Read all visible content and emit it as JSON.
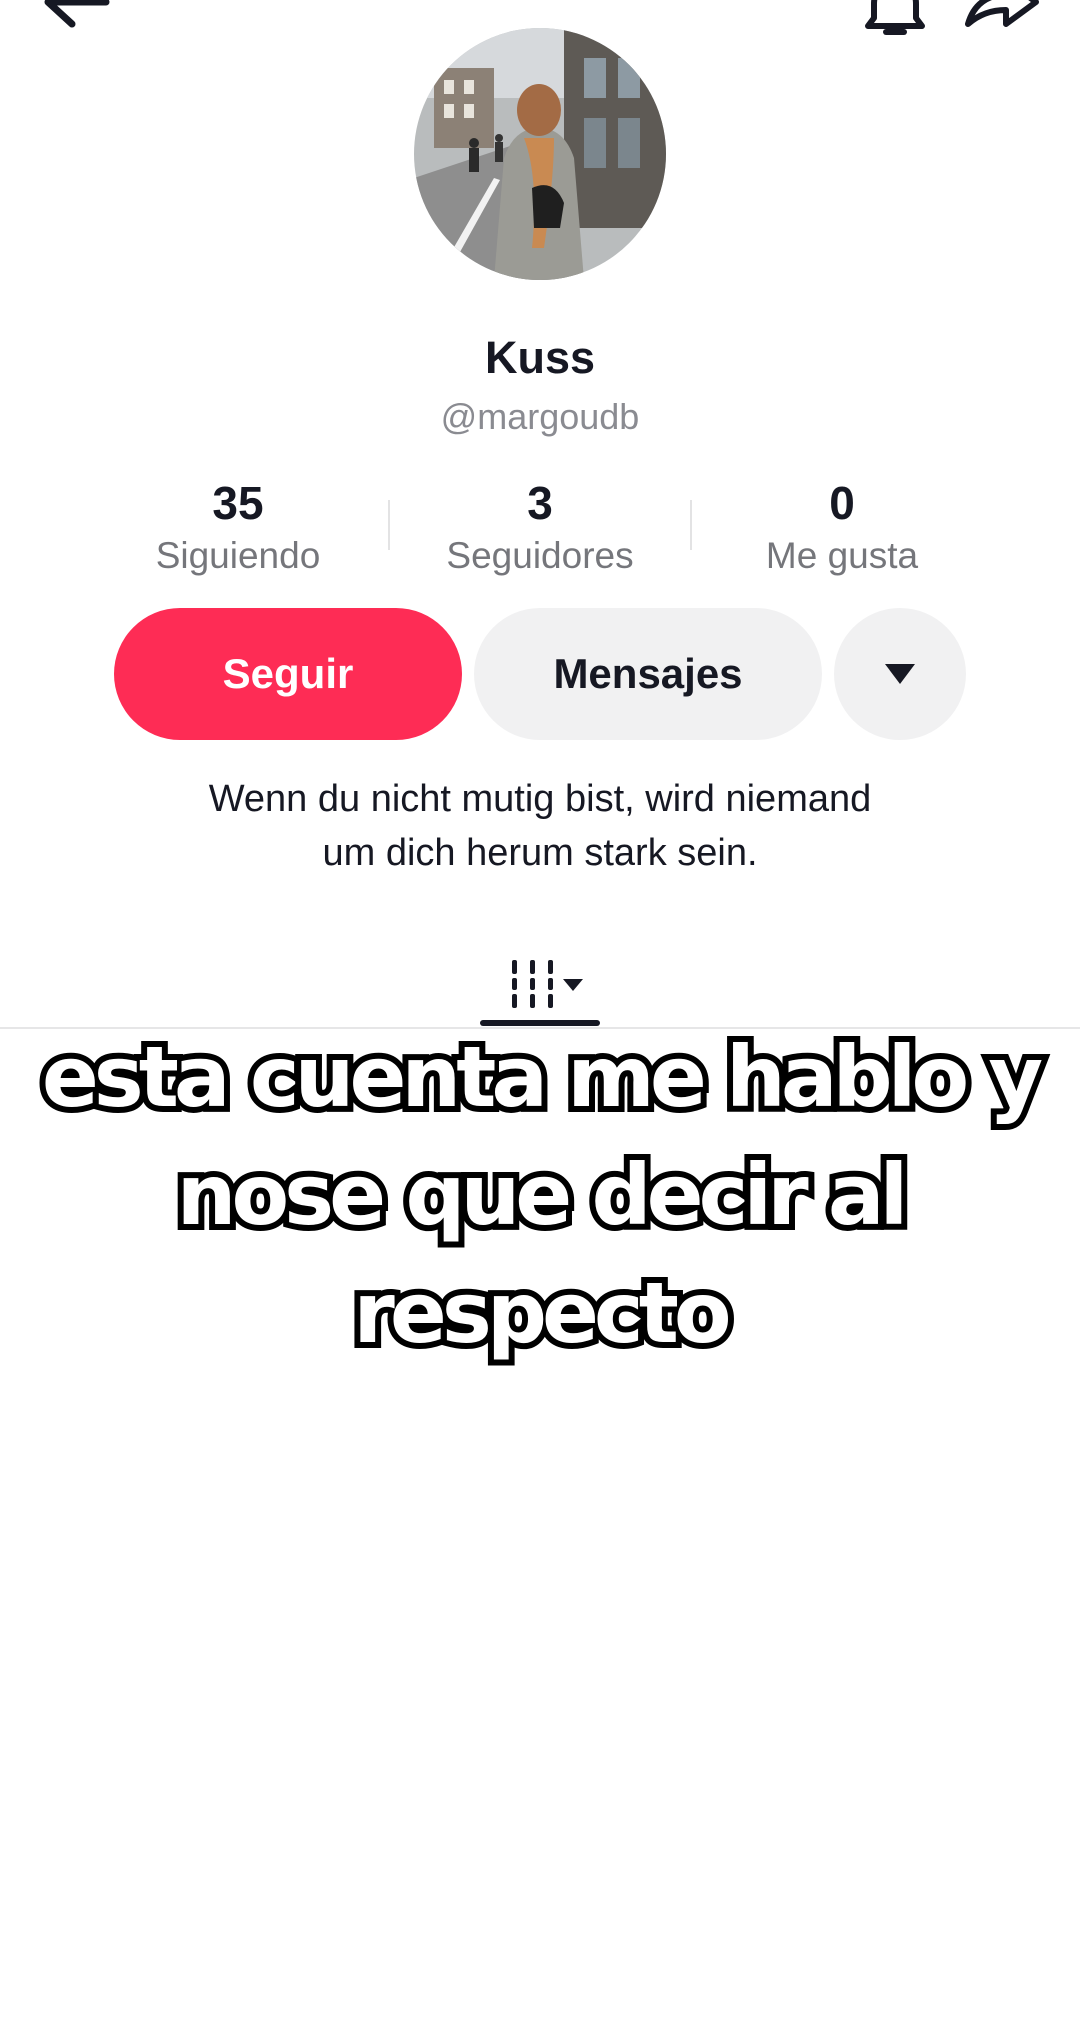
{
  "profile": {
    "display_name": "Kuss",
    "username": "@margoudb",
    "bio_line1": "Wenn du nicht mutig bist, wird niemand",
    "bio_line2": "um dich herum stark sein."
  },
  "stats": [
    {
      "value": "35",
      "label": "Siguiendo"
    },
    {
      "value": "3",
      "label": "Seguidores"
    },
    {
      "value": "0",
      "label": "Me gusta"
    }
  ],
  "actions": {
    "follow_label": "Seguir",
    "message_label": "Mensajes"
  },
  "icons": {
    "back": "arrow-left-icon",
    "bell": "bell-icon",
    "share": "share-arrow-icon",
    "more": "caret-down-icon",
    "grid": "grid-videos-icon"
  },
  "colors": {
    "follow_button": "#fe2c55",
    "secondary_button": "#f1f1f2",
    "text_primary": "#161823",
    "text_secondary": "#8a8b91"
  },
  "caption": {
    "line1": "esta cuenta me hablo y",
    "line2": "nose que decir al",
    "line3": "respecto"
  }
}
